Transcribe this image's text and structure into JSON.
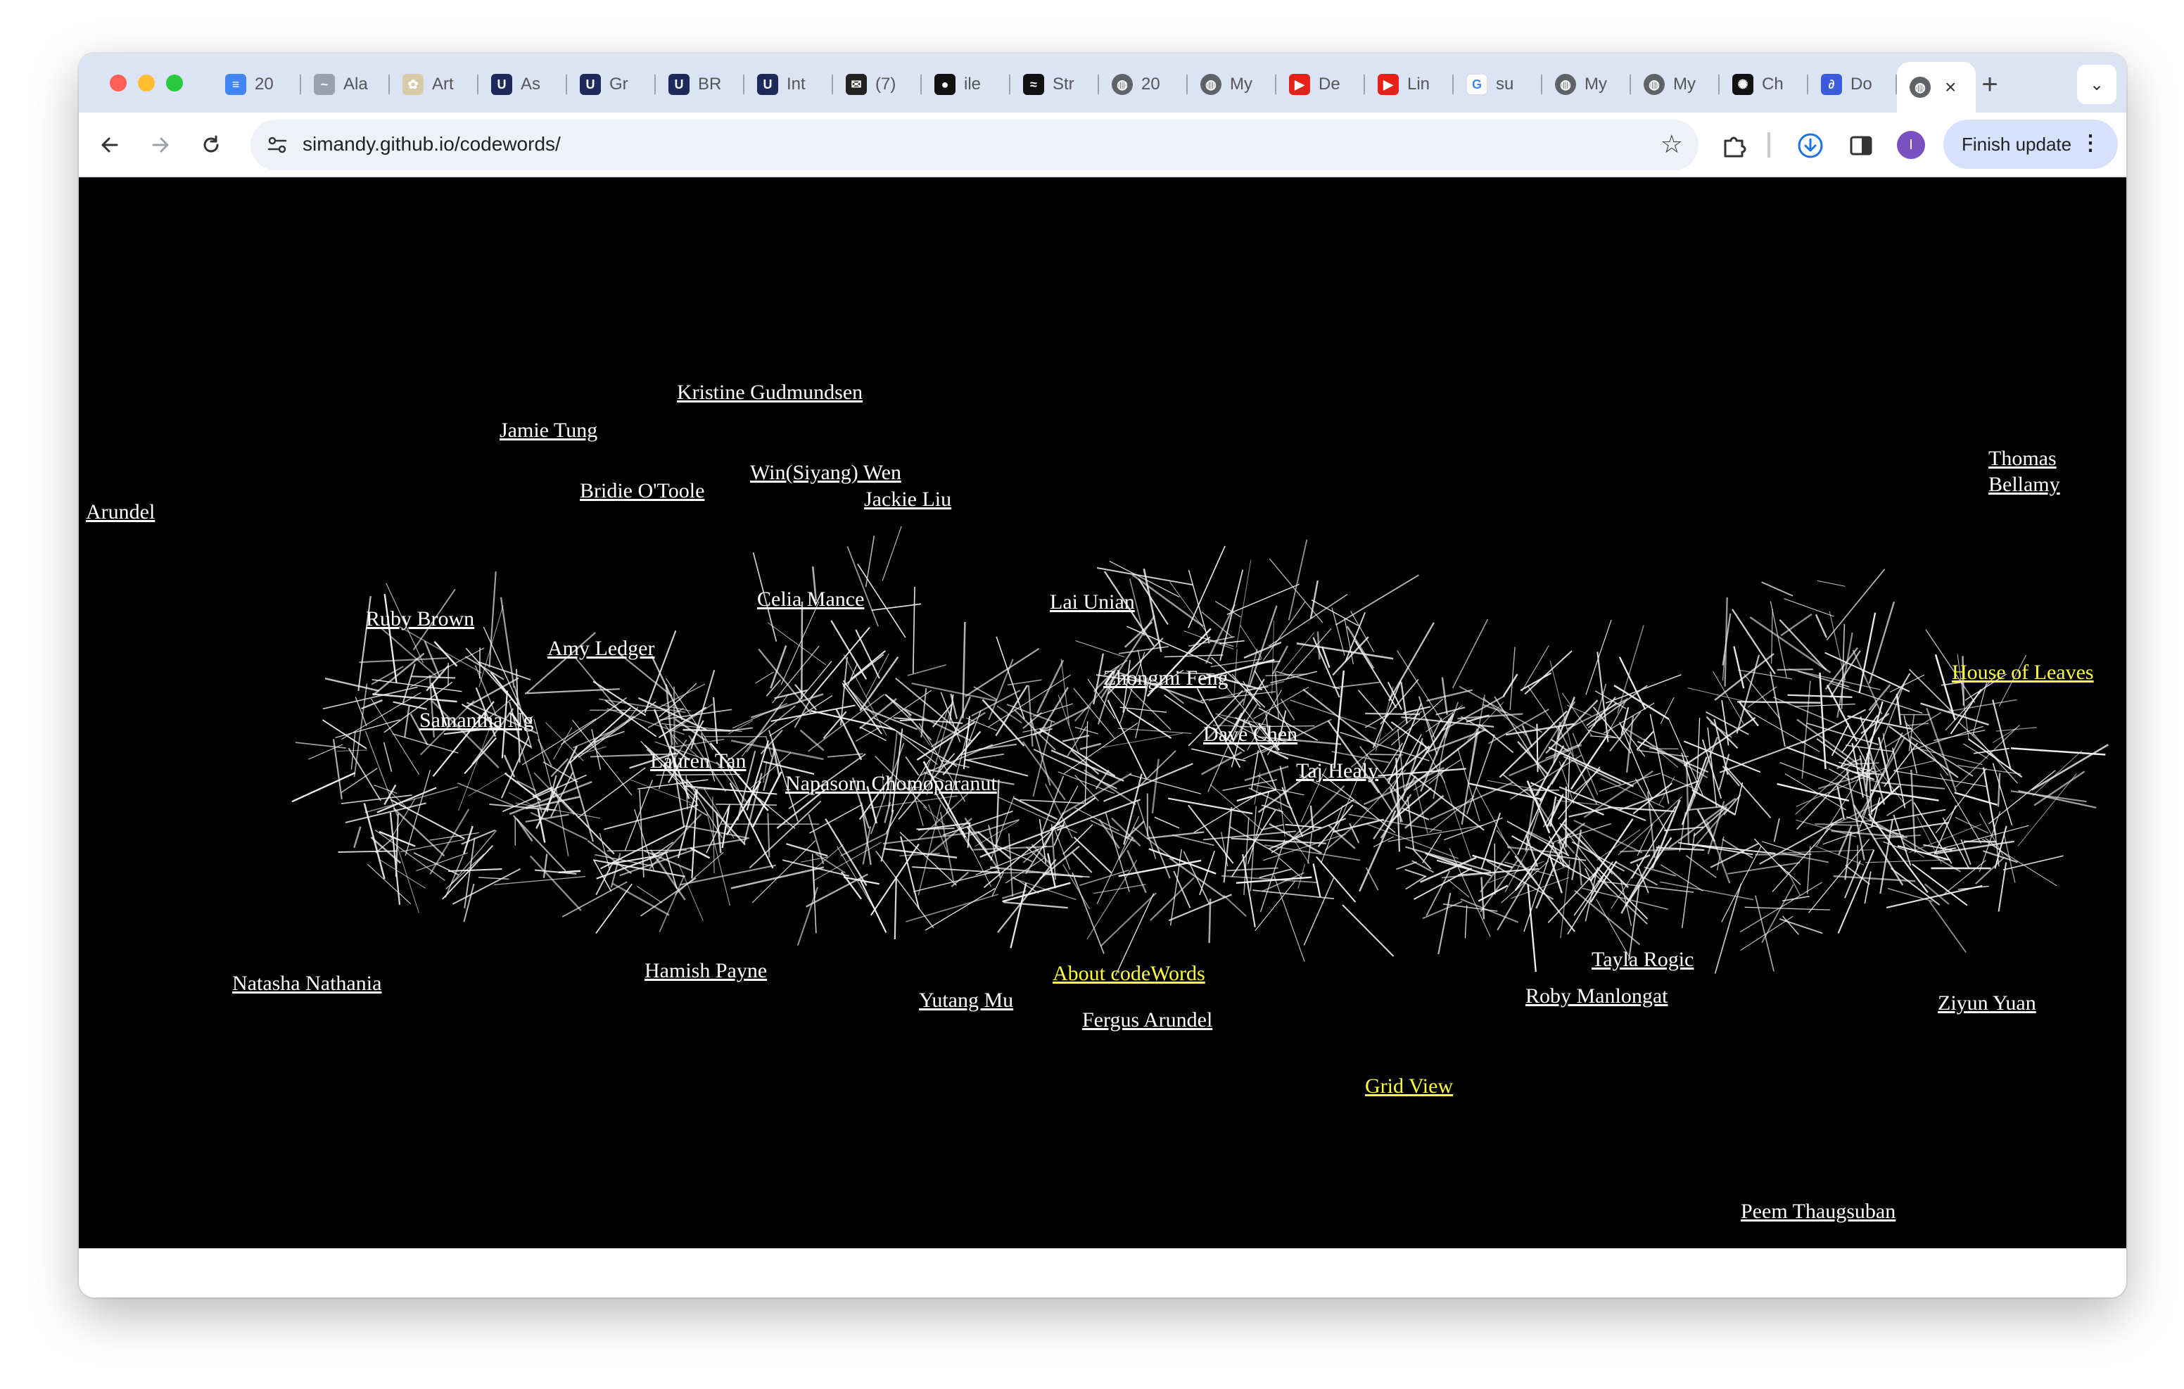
{
  "browser": {
    "tabs": [
      {
        "title": "20",
        "icon": "google-docs-icon",
        "color": "#4285f4",
        "glyph": "≡"
      },
      {
        "title": "Ala",
        "icon": "site-logo-icon",
        "color": "#9aa0ac",
        "glyph": "~"
      },
      {
        "title": "Art",
        "icon": "flower-icon",
        "color": "#d8c9a8",
        "glyph": "✿"
      },
      {
        "title": "As",
        "icon": "university-crest-icon",
        "color": "#1d2a5b",
        "glyph": "U"
      },
      {
        "title": "Gr",
        "icon": "university-crest-icon",
        "color": "#1d2a5b",
        "glyph": "U"
      },
      {
        "title": "BR",
        "icon": "university-crest-icon",
        "color": "#1d2a5b",
        "glyph": "U"
      },
      {
        "title": "Int",
        "icon": "university-crest-icon",
        "color": "#1d2a5b",
        "glyph": "U"
      },
      {
        "title": "(7)",
        "icon": "mail-icon",
        "color": "#222222",
        "glyph": "✉"
      },
      {
        "title": "ile",
        "icon": "github-icon",
        "color": "#111111",
        "glyph": "●"
      },
      {
        "title": "Str",
        "icon": "stripe-logo-icon",
        "color": "#111111",
        "glyph": "≈"
      },
      {
        "title": "20",
        "icon": "globe-icon",
        "color": "#5f6368",
        "glyph": "◍"
      },
      {
        "title": "My",
        "icon": "globe-icon",
        "color": "#5f6368",
        "glyph": "◍"
      },
      {
        "title": "De",
        "icon": "youtube-icon",
        "color": "#e62117",
        "glyph": "▶"
      },
      {
        "title": "Lin",
        "icon": "youtube-icon",
        "color": "#e62117",
        "glyph": "▶"
      },
      {
        "title": "su",
        "icon": "google-icon",
        "color": "#ffffff",
        "glyph": "G"
      },
      {
        "title": "My",
        "icon": "globe-icon",
        "color": "#5f6368",
        "glyph": "◍"
      },
      {
        "title": "My",
        "icon": "globe-icon",
        "color": "#5f6368",
        "glyph": "◍"
      },
      {
        "title": "Ch",
        "icon": "chatgpt-icon",
        "color": "#111111",
        "glyph": "✺"
      },
      {
        "title": "Do",
        "icon": "link-icon",
        "color": "#3b5bdb",
        "glyph": "∂"
      }
    ],
    "active_tab": {
      "title": "",
      "icon": "globe-icon",
      "close": "×"
    },
    "new_tab": "+",
    "tab_menu": "⌄",
    "url": "simandy.github.io/codewords/",
    "avatar_letter": "I",
    "update_button": "Finish update",
    "kebab": "⋮"
  },
  "page": {
    "background_color": "#000000",
    "link_color": "#ffffff",
    "highlight_color": "#ffff3a",
    "title_art_text": "codewords",
    "names": [
      "Kristine Gudmundsen",
      "Jamie Tung",
      "Win(Siyang) Wen",
      "Bridie O'Toole",
      "Jackie Liu",
      "Arundel",
      "Thomas Bellamy",
      "Celia Mance",
      "Lai Unian",
      "Ruby Brown",
      "Amy Ledger",
      "Zhongmi Feng",
      "Samantha Ng",
      "Dave Chen",
      "Lauren Tan",
      "Taj Healy",
      "Napasorn Chomoparanut",
      "Tayla Rogic",
      "Natasha Nathania",
      "Hamish Payne",
      "Roby Manlongat",
      "Yutang Mu",
      "Ziyun Yuan",
      "Fergus Arundel",
      "Peem Thaugsuban"
    ],
    "nav": {
      "house_of_leaves": "House of Leaves",
      "about": "About codeWords",
      "grid_view": "Grid View"
    }
  }
}
